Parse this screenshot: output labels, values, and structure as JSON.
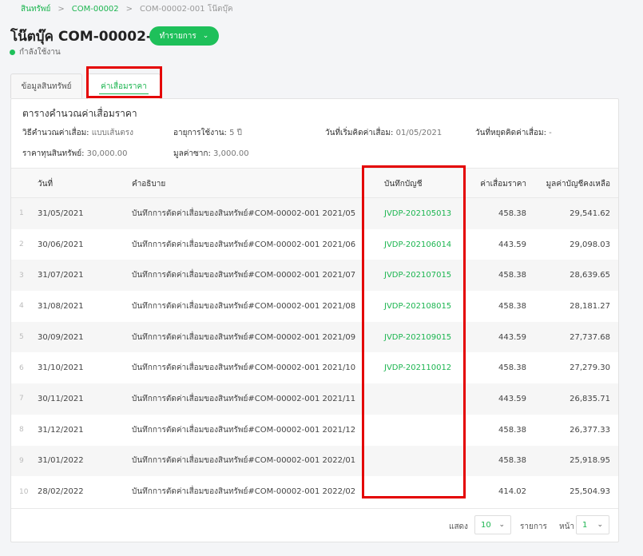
{
  "breadcrumb": {
    "items": [
      "สินทรัพย์",
      "COM-00002"
    ],
    "current": "COM-00002-001 โน๊ตบุ๊ค",
    "separator": ">"
  },
  "header": {
    "title": "โน๊ตบุ๊ค COM-00002-001",
    "action_label": "ทำรายการ",
    "status": "กำลังใช้งาน",
    "status_color": "#1ec05a"
  },
  "tabs": [
    {
      "label": "ข้อมูลสินทรัพย์",
      "active": false
    },
    {
      "label": "ค่าเสื่อมราคา",
      "active": true
    }
  ],
  "panel": {
    "title": "ตารางคำนวณค่าเสื่อมราคา",
    "info": {
      "method_label": "วิธีคำนวณค่าเสื่อม:",
      "method_value": "แบบเส้นตรง",
      "life_label": "อายุการใช้งาน:",
      "life_value": "5 ปี",
      "start_label": "วันที่เริ่มคิดค่าเสื่อม:",
      "start_value": "01/05/2021",
      "stop_label": "วันที่หยุดคิดค่าเสื่อม:",
      "stop_value": "-",
      "cost_label": "ราคาทุนสินทรัพย์:",
      "cost_value": "30,000.00",
      "salvage_label": "มูลค่าซาก:",
      "salvage_value": "3,000.00"
    }
  },
  "table": {
    "columns": {
      "date": "วันที่",
      "description": "คำอธิบาย",
      "account": "บันทึกบัญชี",
      "depreciation": "ค่าเสื่อมราคา",
      "book_value": "มูลค่าบัญชีคงเหลือ"
    },
    "rows": [
      {
        "idx": "1",
        "date": "31/05/2021",
        "desc": "บันทึกการตัดค่าเสื่อมของสินทรัพย์#COM-00002-001 2021/05",
        "account": "JVDP-202105013",
        "dep": "458.38",
        "book": "29,541.62"
      },
      {
        "idx": "2",
        "date": "30/06/2021",
        "desc": "บันทึกการตัดค่าเสื่อมของสินทรัพย์#COM-00002-001 2021/06",
        "account": "JVDP-202106014",
        "dep": "443.59",
        "book": "29,098.03"
      },
      {
        "idx": "3",
        "date": "31/07/2021",
        "desc": "บันทึกการตัดค่าเสื่อมของสินทรัพย์#COM-00002-001 2021/07",
        "account": "JVDP-202107015",
        "dep": "458.38",
        "book": "28,639.65"
      },
      {
        "idx": "4",
        "date": "31/08/2021",
        "desc": "บันทึกการตัดค่าเสื่อมของสินทรัพย์#COM-00002-001 2021/08",
        "account": "JVDP-202108015",
        "dep": "458.38",
        "book": "28,181.27"
      },
      {
        "idx": "5",
        "date": "30/09/2021",
        "desc": "บันทึกการตัดค่าเสื่อมของสินทรัพย์#COM-00002-001 2021/09",
        "account": "JVDP-202109015",
        "dep": "443.59",
        "book": "27,737.68"
      },
      {
        "idx": "6",
        "date": "31/10/2021",
        "desc": "บันทึกการตัดค่าเสื่อมของสินทรัพย์#COM-00002-001 2021/10",
        "account": "JVDP-202110012",
        "dep": "458.38",
        "book": "27,279.30"
      },
      {
        "idx": "7",
        "date": "30/11/2021",
        "desc": "บันทึกการตัดค่าเสื่อมของสินทรัพย์#COM-00002-001 2021/11",
        "account": "",
        "dep": "443.59",
        "book": "26,835.71"
      },
      {
        "idx": "8",
        "date": "31/12/2021",
        "desc": "บันทึกการตัดค่าเสื่อมของสินทรัพย์#COM-00002-001 2021/12",
        "account": "",
        "dep": "458.38",
        "book": "26,377.33"
      },
      {
        "idx": "9",
        "date": "31/01/2022",
        "desc": "บันทึกการตัดค่าเสื่อมของสินทรัพย์#COM-00002-001 2022/01",
        "account": "",
        "dep": "458.38",
        "book": "25,918.95"
      },
      {
        "idx": "10",
        "date": "28/02/2022",
        "desc": "บันทึกการตัดค่าเสื่อมของสินทรัพย์#COM-00002-001 2022/02",
        "account": "",
        "dep": "414.02",
        "book": "25,504.93"
      }
    ]
  },
  "pagination": {
    "show_label": "แสดง",
    "page_size": "10",
    "items_label": "รายการ",
    "page_label": "หน้า",
    "page": "1"
  },
  "colors": {
    "accent": "#1cb550",
    "highlight": "#e40000"
  }
}
